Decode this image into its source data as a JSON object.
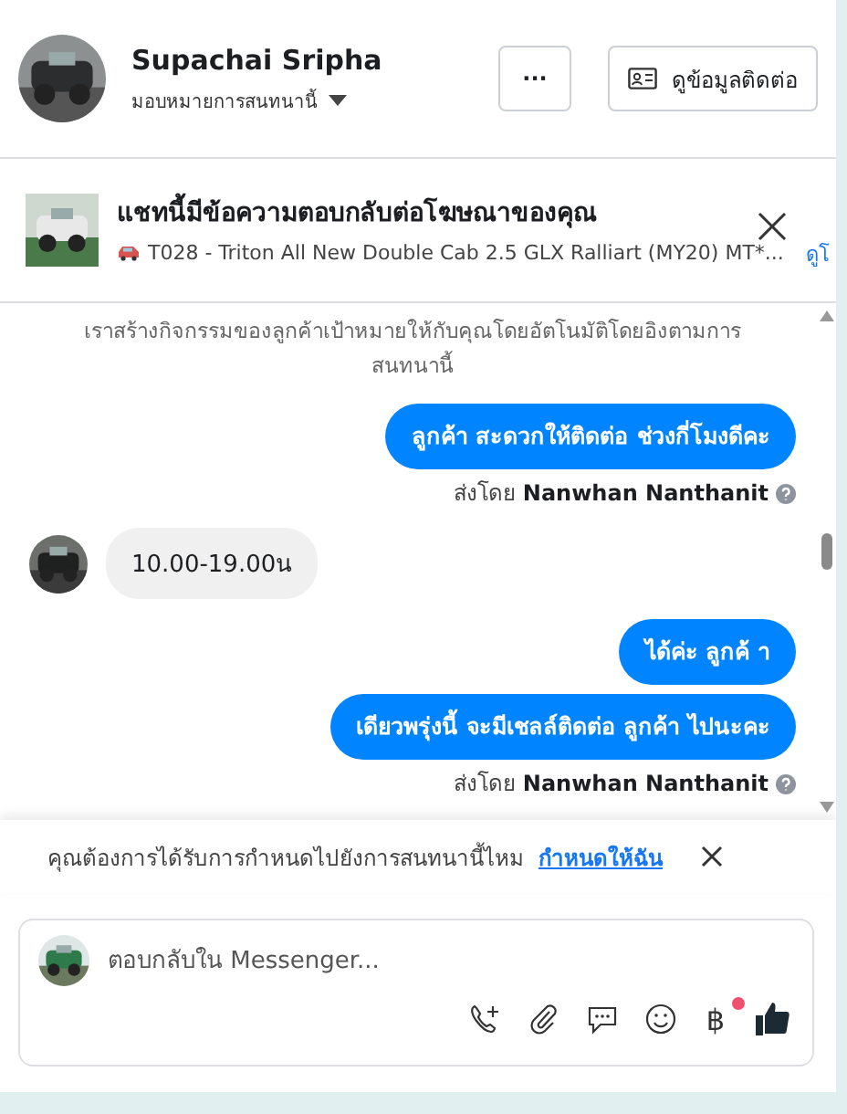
{
  "header": {
    "name": "Supachai Sripha",
    "assign_label": "มอบหมายการสนทนานี้",
    "more_button": "···",
    "contact_button": "ดูข้อมูลติดต่อ"
  },
  "ad_notice": {
    "title": "แชทนี้มีข้อความตอบกลับต่อโฆษณาของคุณ",
    "subtitle": "T028 - Triton All New Double Cab 2.5 GLX Ralliart (MY20) MT*...",
    "link": "ดูโ"
  },
  "messages": [
    {
      "kind": "notice",
      "text": "เราสร้างกิจกรรมของลูกค้าเป้าหมายให้กับคุณโดยอัตโนมัติโดยอิงตามการสนทนานี้"
    },
    {
      "kind": "outgoing",
      "text": "ลูกค้า สะดวกให้ติดต่อ ช่วงกี่โมงดีคะ"
    },
    {
      "kind": "sent_by",
      "label": "ส่งโดย",
      "name": "Nanwhan Nanthanit"
    },
    {
      "kind": "incoming",
      "text": "10.00-19.00น"
    },
    {
      "kind": "outgoing",
      "text": "ได้ค่ะ  ลูกค้ า"
    },
    {
      "kind": "outgoing",
      "text": "เดียวพรุ่งนี้ จะมีเชลล์ติดต่อ ลูกค้า ไปนะคะ"
    },
    {
      "kind": "sent_by",
      "label": "ส่งโดย",
      "name": "Nanwhan Nanthanit"
    }
  ],
  "assign_banner": {
    "text": "คุณต้องการได้รับการกำหนดไปยังการสนทนานี้ไหม",
    "link": "กำหนดให้ฉัน"
  },
  "composer": {
    "placeholder": "ตอบกลับใน Messenger...",
    "currency_symbol": "฿",
    "currency_badge": true
  }
}
